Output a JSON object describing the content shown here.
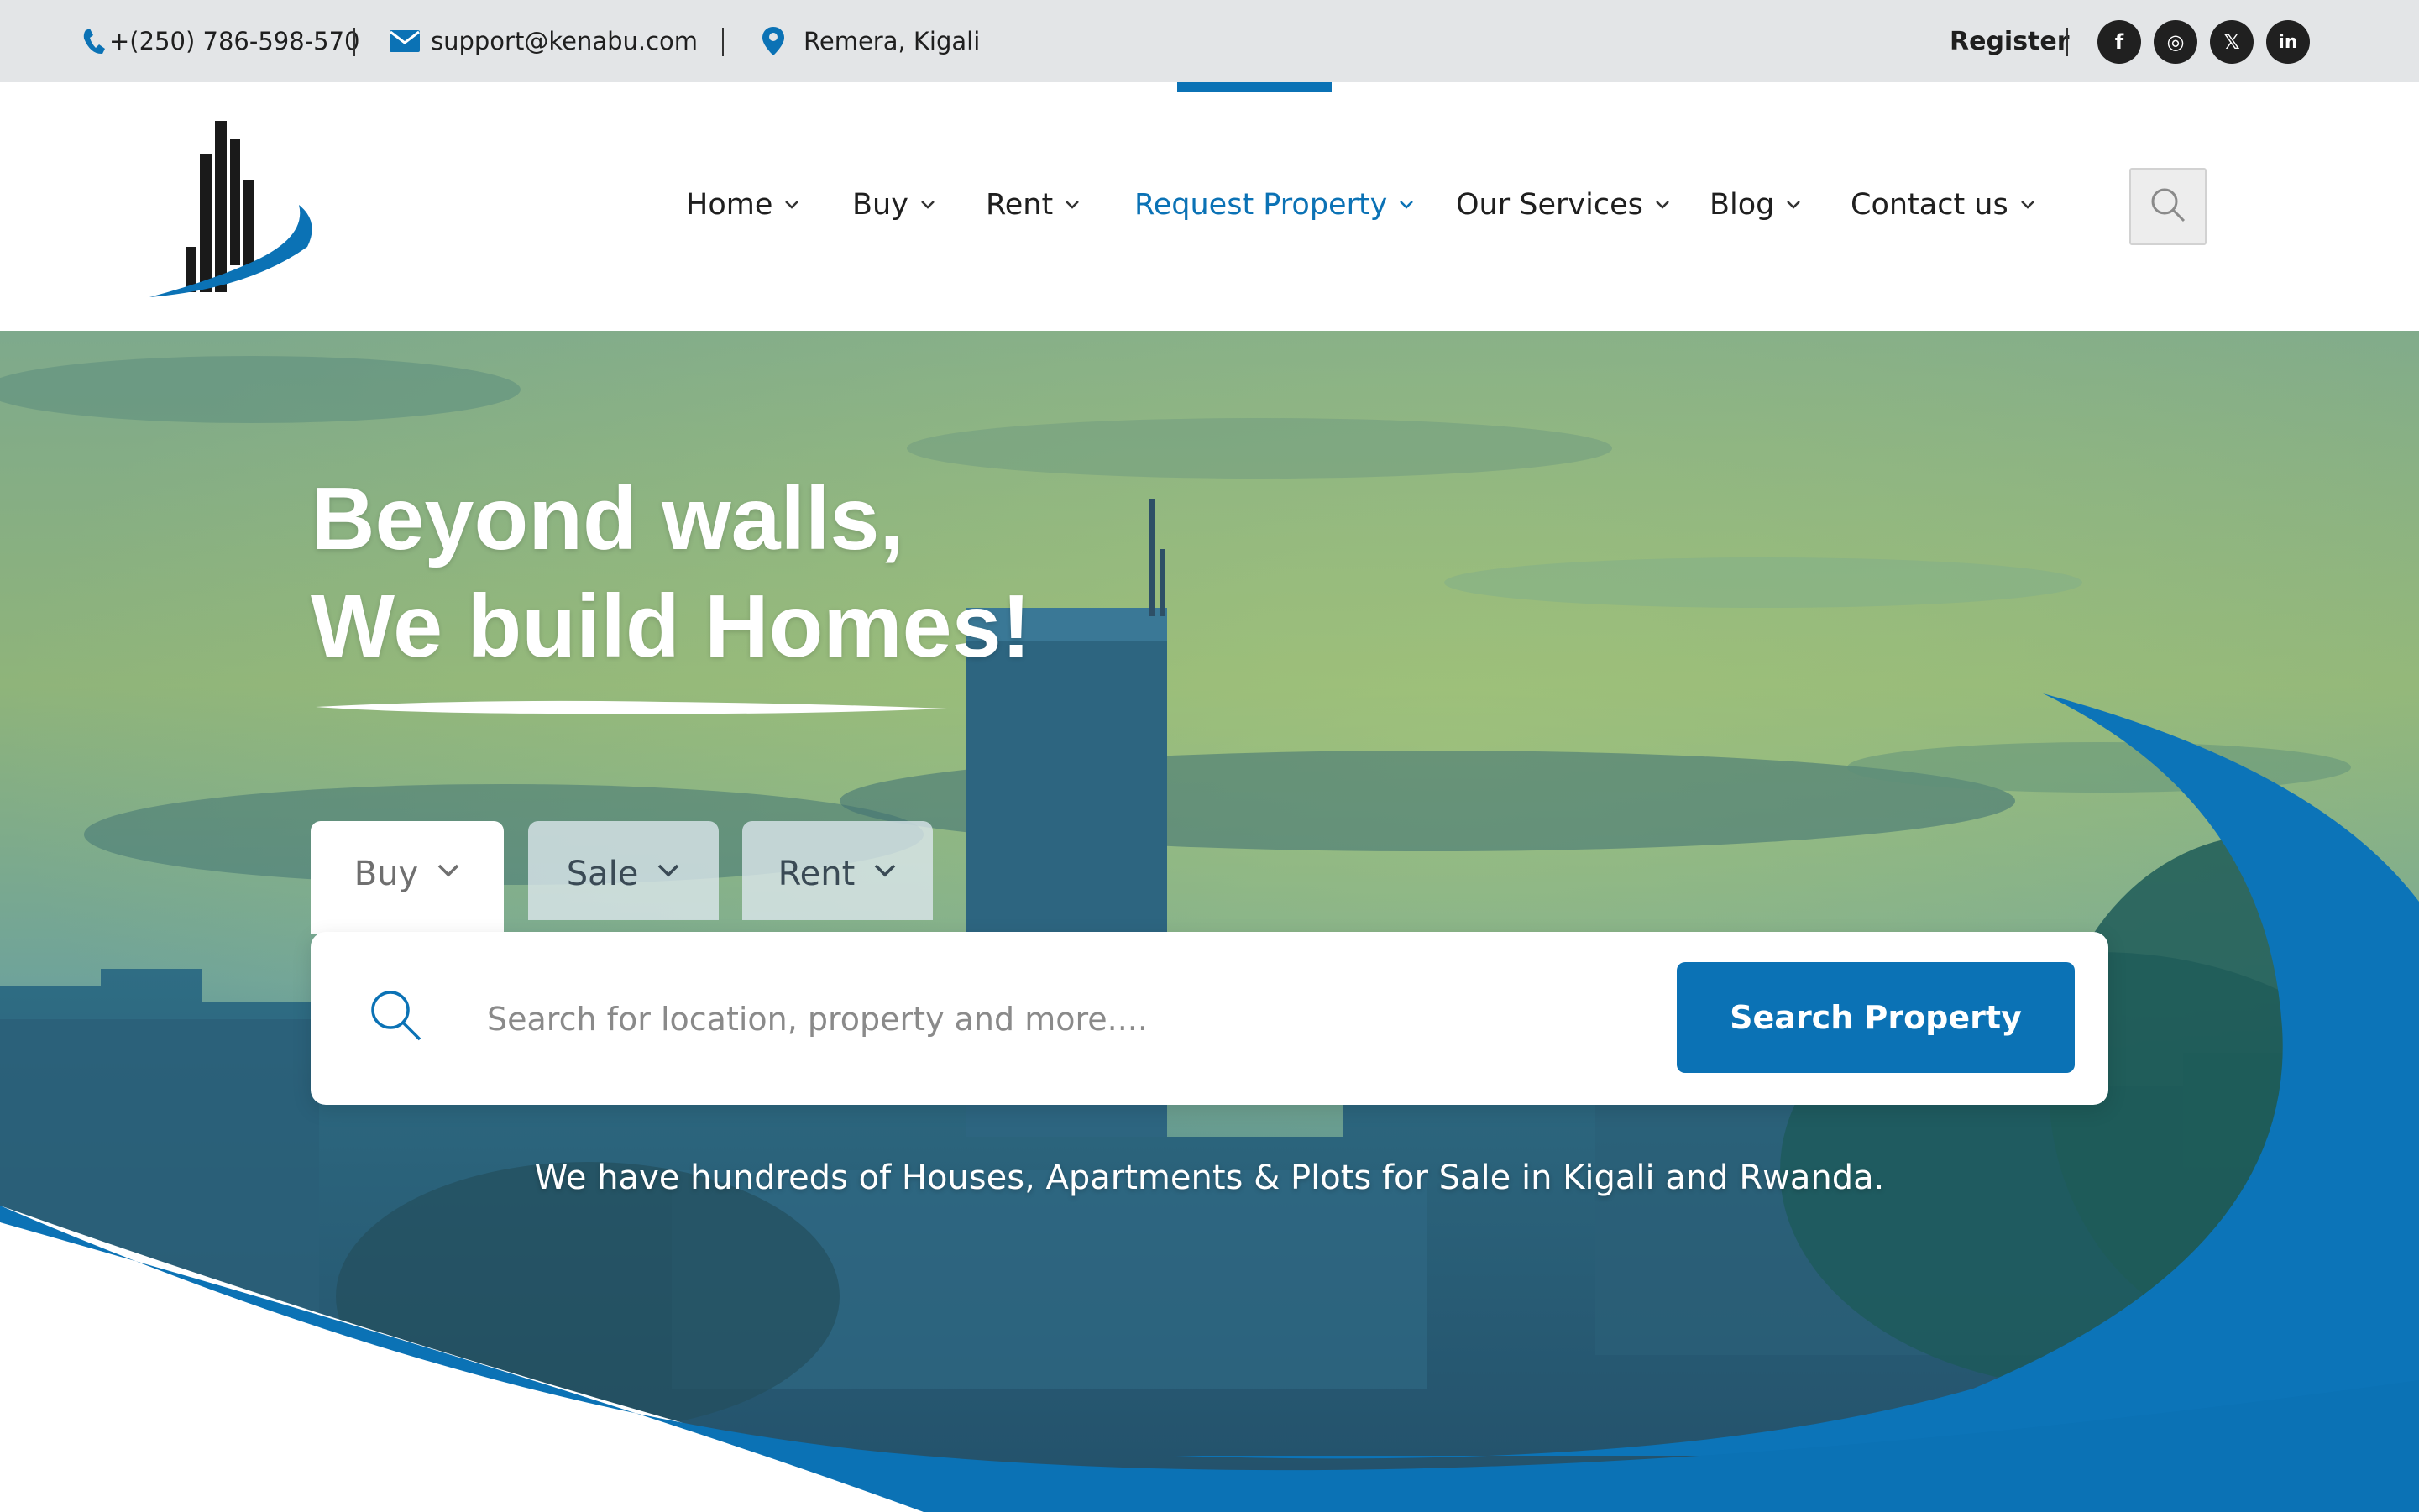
{
  "topbar": {
    "phone": "+(250) 786-598-570",
    "email": "support@kenabu.com",
    "location": "Remera, Kigali",
    "register_label": "Register",
    "social": [
      {
        "name": "facebook",
        "glyph": "f"
      },
      {
        "name": "instagram",
        "glyph": "◎"
      },
      {
        "name": "x",
        "glyph": "𝕏"
      },
      {
        "name": "linkedin",
        "glyph": "in"
      }
    ]
  },
  "nav": {
    "items": [
      {
        "label": "Home"
      },
      {
        "label": "Buy"
      },
      {
        "label": "Rent"
      },
      {
        "label": "Request Property"
      },
      {
        "label": "Our Services"
      },
      {
        "label": "Blog"
      },
      {
        "label": "Contact us"
      }
    ],
    "active": "Request Property"
  },
  "hero": {
    "headline_line1": "Beyond walls,",
    "headline_line2": "We build Homes!",
    "tabs": [
      {
        "label": "Buy"
      },
      {
        "label": "Sale"
      },
      {
        "label": "Rent"
      }
    ],
    "search_placeholder": "Search for location, property and more....",
    "search_button": "Search Property",
    "tagline": "We have hundreds of Houses, Apartments & Plots for Sale in Kigali and Rwanda."
  },
  "colors": {
    "brand_blue": "#0b72b5",
    "topbar_bg": "#e3e5e7",
    "text_dark": "#1f1f1f"
  },
  "icons": [
    "phone-icon",
    "mail-icon",
    "location-pin-icon",
    "search-icon",
    "chevron-down-icon"
  ]
}
